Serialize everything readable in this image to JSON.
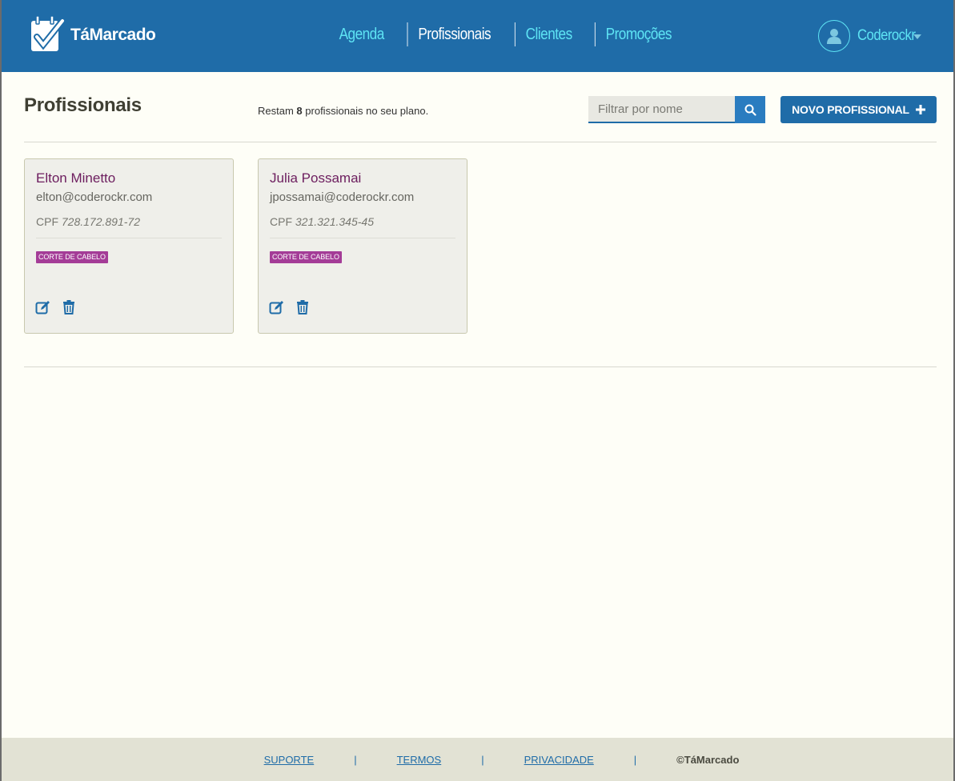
{
  "header": {
    "brand": "TáMarcado",
    "nav": [
      {
        "label": "Agenda",
        "active": false
      },
      {
        "label": "Profissionais",
        "active": true
      },
      {
        "label": "Clientes",
        "active": false
      },
      {
        "label": "Promoções",
        "active": false
      }
    ],
    "user_name": "Coderockr",
    "brand_color": "#1f6ca8",
    "nav_link_color": "#5ee4f4"
  },
  "page": {
    "title": "Profissionais",
    "plan_note_prefix": "Restam",
    "plan_remaining": "8",
    "plan_note_suffix": "profissionais no seu plano.",
    "search_placeholder": "Filtrar por nome",
    "new_button_label": "NOVO PROFISSIONAL"
  },
  "professionals": [
    {
      "name": "Elton Minetto",
      "email": "elton@coderockr.com",
      "cpf_label": "CPF",
      "cpf": "728.172.891-72",
      "services": [
        "CORTE DE CABELO"
      ]
    },
    {
      "name": "Julia Possamai",
      "email": "jpossamai@coderockr.com",
      "cpf_label": "CPF",
      "cpf": "321.321.345-45",
      "services": [
        "CORTE DE CABELO"
      ]
    }
  ],
  "footer": {
    "links": [
      "SUPORTE",
      "TERMOS",
      "PRIVACIDADE"
    ],
    "separator": "|",
    "copyright": "©TáMarcado"
  },
  "colors": {
    "service_badge": "#a43c97",
    "name_color": "#6c1d5e",
    "footer_bg": "#e2e2d4"
  },
  "icons": {
    "edit": "edit-icon",
    "delete": "trash-icon",
    "search": "search-icon",
    "plus": "plus-icon",
    "user": "user-icon",
    "caret": "caret-down-icon"
  }
}
